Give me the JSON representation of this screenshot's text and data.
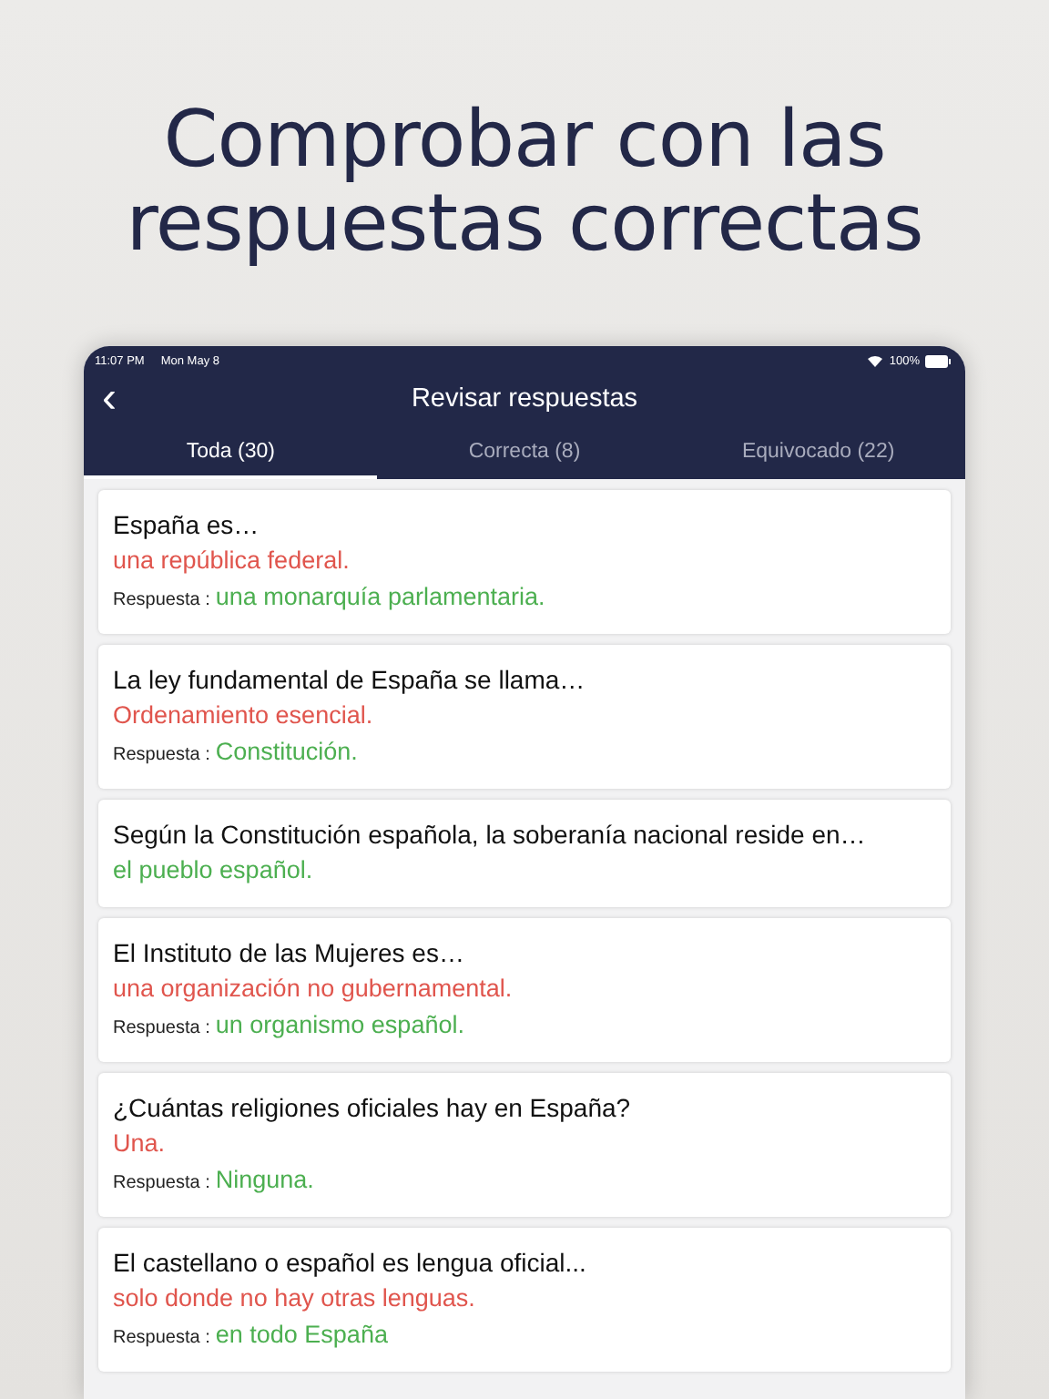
{
  "headline": "Comprobar con las respuestas correctas",
  "status_bar": {
    "time": "11:07 PM",
    "date": "Mon May 8",
    "battery": "100%"
  },
  "header": {
    "back": "‹",
    "title": "Revisar respuestas"
  },
  "tabs": [
    {
      "label": "Toda (30)",
      "selected": true
    },
    {
      "label": "Correcta (8)",
      "selected": false
    },
    {
      "label": "Equivocado (22)",
      "selected": false
    }
  ],
  "questions": [
    {
      "question": "España es…",
      "answer": "una república federal.",
      "correct": false,
      "answer_label": "Respuesta :",
      "correct_answer": "una monarquía parlamentaria."
    },
    {
      "question": "La ley fundamental de España se llama…",
      "answer": "Ordenamiento esencial.",
      "correct": false,
      "answer_label": "Respuesta :",
      "correct_answer": "Constitución."
    },
    {
      "question": "Según la Constitución española, la soberanía nacional reside en…",
      "answer": "el pueblo español.",
      "correct": true
    },
    {
      "question": "El Instituto de las Mujeres es…",
      "answer": "una organización no gubernamental.",
      "correct": false,
      "answer_label": "Respuesta :",
      "correct_answer": "un organismo español."
    },
    {
      "question": "¿Cuántas religiones oficiales hay en España?",
      "answer": "Una.",
      "correct": false,
      "answer_label": "Respuesta :",
      "correct_answer": "Ninguna."
    },
    {
      "question": "El castellano o español es lengua oficial...",
      "answer": "solo donde no hay otras lenguas.",
      "correct": false,
      "answer_label": "Respuesta :",
      "correct_answer": "en todo España"
    }
  ]
}
